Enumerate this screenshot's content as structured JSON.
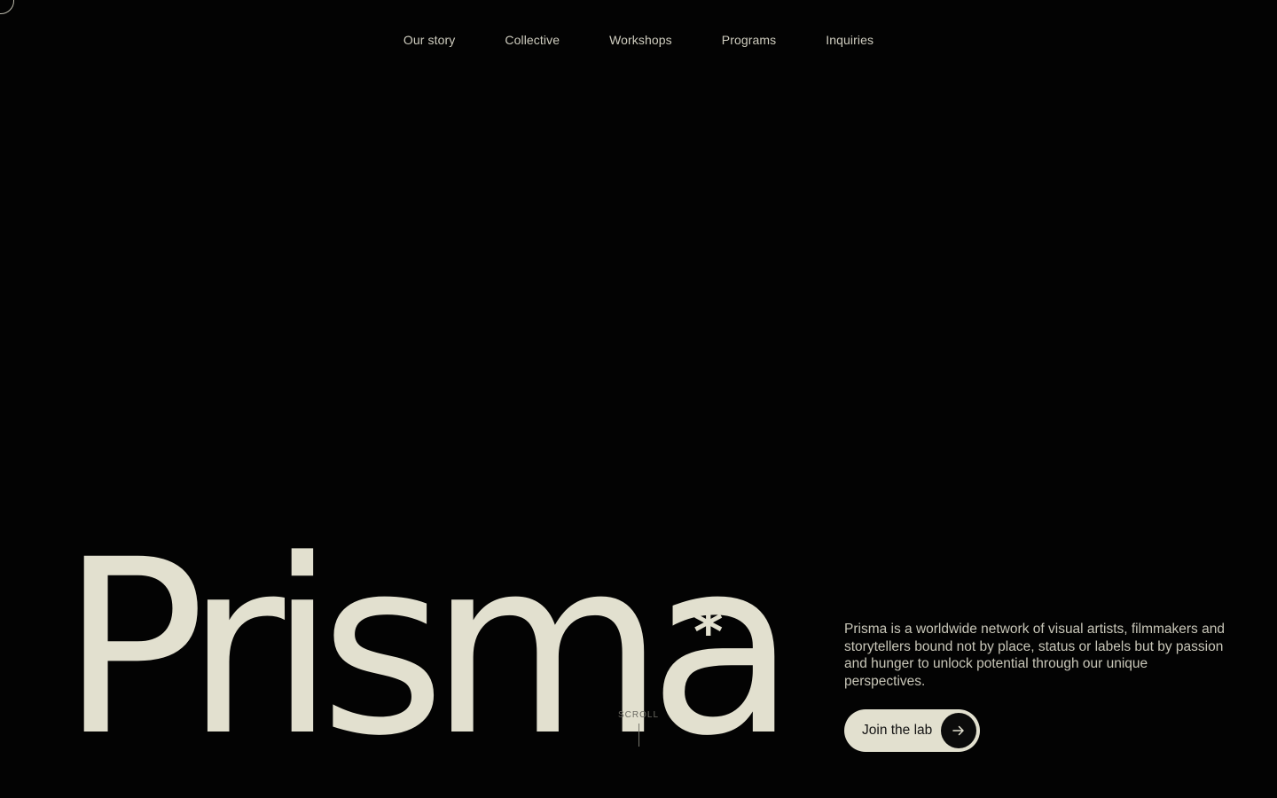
{
  "nav": {
    "items": [
      {
        "label": "Our story"
      },
      {
        "label": "Collective"
      },
      {
        "label": "Workshops"
      },
      {
        "label": "Programs"
      },
      {
        "label": "Inquiries"
      }
    ]
  },
  "hero": {
    "brand": "Prisma",
    "asterisk": "*",
    "scroll_label": "SCROLL",
    "description": "Prisma is a worldwide network of visual artists, filmmakers and storytellers bound not by place, status or labels but by passion and hunger to unlock potential through our unique perspectives.",
    "cta_label": "Join the lab",
    "cta_icon": "arrow-right-icon"
  },
  "colors": {
    "background": "#030303",
    "foreground": "#e2e0cf",
    "button_bg": "#e2e0cf",
    "arrow_bg": "#0b0b0b"
  }
}
